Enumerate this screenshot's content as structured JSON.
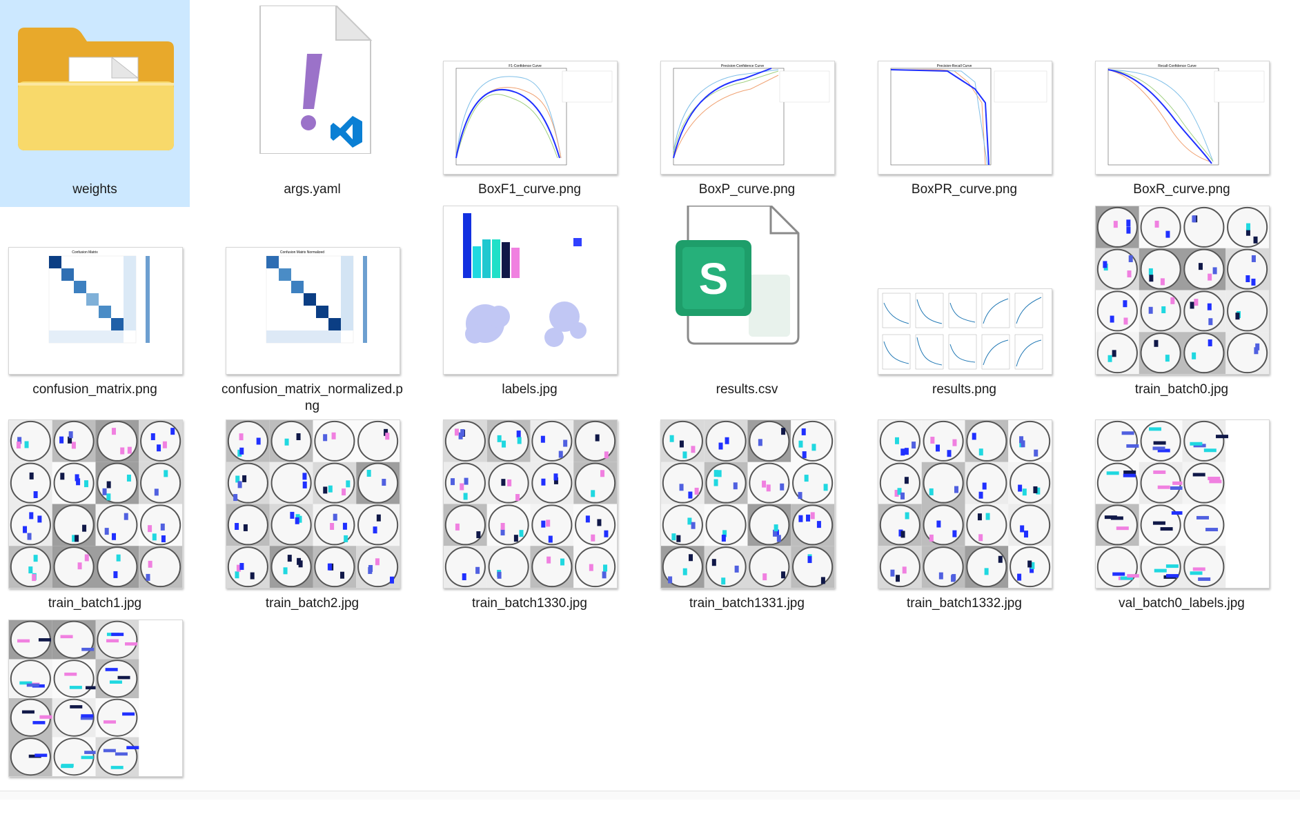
{
  "files": [
    {
      "name": "weights",
      "type": "folder",
      "icon": "folder-icon"
    },
    {
      "name": "args.yaml",
      "type": "yaml",
      "icon": "vscode-yaml-file-icon"
    },
    {
      "name": "BoxF1_curve.png",
      "type": "image",
      "preview": "curve-chart",
      "chart_title": "F1-Confidence Curve"
    },
    {
      "name": "BoxP_curve.png",
      "type": "image",
      "preview": "curve-chart",
      "chart_title": "Precision-Confidence Curve"
    },
    {
      "name": "BoxPR_curve.png",
      "type": "image",
      "preview": "curve-chart",
      "chart_title": "Precision-Recall Curve"
    },
    {
      "name": "BoxR_curve.png",
      "type": "image",
      "preview": "curve-chart",
      "chart_title": "Recall-Confidence Curve"
    },
    {
      "name": "confusion_matrix.png",
      "type": "image",
      "preview": "matrix",
      "chart_title": "Confusion Matrix"
    },
    {
      "name": "confusion_matrix_normalized.png",
      "type": "image",
      "preview": "matrix",
      "chart_title": "Confusion Matrix Normalized"
    },
    {
      "name": "labels.jpg",
      "type": "image",
      "preview": "labels-plot"
    },
    {
      "name": "results.csv",
      "type": "csv",
      "icon": "spreadsheet-csv-icon"
    },
    {
      "name": "results.png",
      "type": "image",
      "preview": "results-grid"
    },
    {
      "name": "train_batch0.jpg",
      "type": "image",
      "preview": "mosaic"
    },
    {
      "name": "train_batch1.jpg",
      "type": "image",
      "preview": "mosaic"
    },
    {
      "name": "train_batch2.jpg",
      "type": "image",
      "preview": "mosaic"
    },
    {
      "name": "train_batch1330.jpg",
      "type": "image",
      "preview": "mosaic"
    },
    {
      "name": "train_batch1331.jpg",
      "type": "image",
      "preview": "mosaic"
    },
    {
      "name": "train_batch1332.jpg",
      "type": "image",
      "preview": "mosaic"
    },
    {
      "name": "val_batch0_labels.jpg",
      "type": "image",
      "preview": "mosaic"
    },
    {
      "name": "",
      "type": "image",
      "preview": "mosaic"
    }
  ],
  "colors": {
    "selection": "#cce8ff",
    "folder": "#f4c542",
    "yaml_accent": "#9b72c9",
    "vscode_blue": "#0a7fd4",
    "csv_green": "#1e9e6a"
  }
}
